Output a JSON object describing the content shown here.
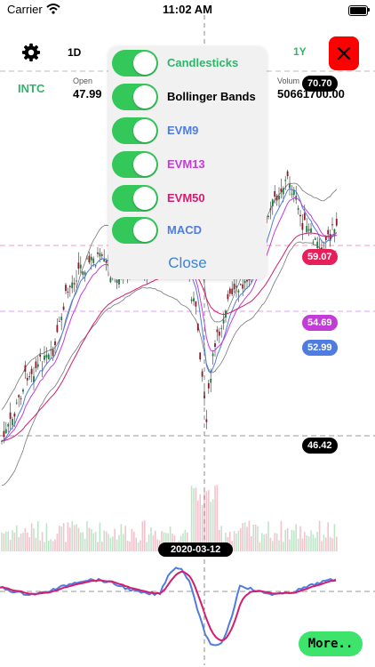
{
  "status_bar": {
    "carrier": "Carrier",
    "time": "11:02 AM"
  },
  "toolbar": {
    "tf_1d": "1D",
    "tf_1y": "1Y"
  },
  "info": {
    "ticker": "INTC",
    "open_label": "Open",
    "open_value": "47.99",
    "volume_label": "Volum",
    "volume_value": "50661700.00"
  },
  "badges": {
    "top": "70.70",
    "red": "59.07",
    "purple": "54.69",
    "blue": "52.99",
    "black": "46.42",
    "date": "2020-03-12"
  },
  "menu": {
    "items": [
      {
        "label": "Candlesticks",
        "color": "#2fb56a",
        "enabled": true
      },
      {
        "label": "Bollinger Bands",
        "color": "#000000",
        "enabled": true
      },
      {
        "label": "EVM9",
        "color": "#4e7ce0",
        "enabled": true
      },
      {
        "label": "EVM13",
        "color": "#c23dd6",
        "enabled": true
      },
      {
        "label": "EVM50",
        "color": "#d61c6e",
        "enabled": true
      },
      {
        "label": "MACD",
        "color": "#4e7ce0",
        "enabled": true
      }
    ],
    "close_label": "Close"
  },
  "more_label": "More.."
}
